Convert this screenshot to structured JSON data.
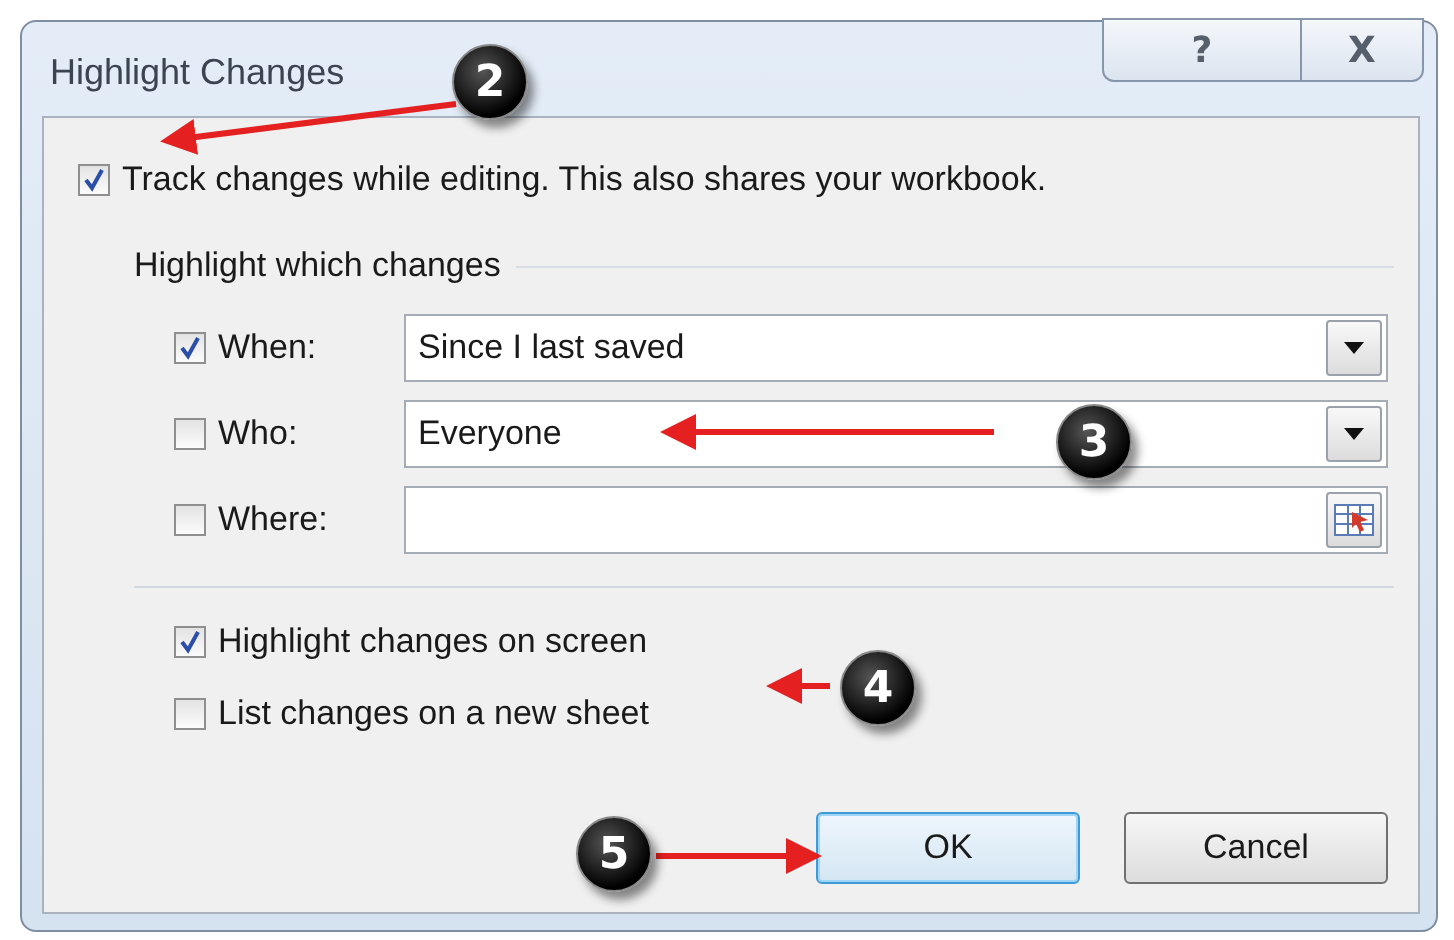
{
  "window": {
    "title": "Highlight Changes",
    "buttons": [
      "?",
      "X"
    ]
  },
  "track_changes": {
    "label": "Track changes while editing. This also shares your workbook.",
    "checked": true
  },
  "group": {
    "title": "Highlight which changes",
    "rows": [
      {
        "label": "When:",
        "checked": true,
        "kind": "dropdown",
        "value": "Since I last saved"
      },
      {
        "label": "Who:",
        "checked": false,
        "kind": "dropdown",
        "value": "Everyone"
      },
      {
        "label": "Where:",
        "checked": false,
        "kind": "range"
      }
    ]
  },
  "options": [
    {
      "label": "Highlight changes on screen",
      "checked": true
    },
    {
      "label": "List changes on a new sheet",
      "checked": false
    }
  ],
  "buttons": [
    {
      "label": "OK",
      "default": true
    },
    {
      "label": "Cancel",
      "default": false
    }
  ],
  "callouts": [
    {
      "label": "2"
    },
    {
      "label": "3"
    },
    {
      "label": "4"
    },
    {
      "label": "5"
    }
  ]
}
